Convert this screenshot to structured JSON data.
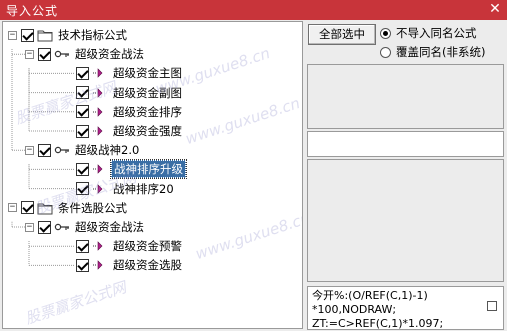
{
  "window": {
    "title": "导入公式",
    "close_glyph": "✕"
  },
  "tree": {
    "nodes": [
      {
        "label": "技术指标公式",
        "type": "folder",
        "expander": "−",
        "checked": true,
        "selected": false
      },
      {
        "label": "超级资金战法",
        "type": "key",
        "expander": "−",
        "checked": true,
        "selected": false
      },
      {
        "label": "超级资金主图",
        "type": "formula",
        "expander": "",
        "checked": true,
        "selected": false
      },
      {
        "label": "超级资金副图",
        "type": "formula",
        "expander": "",
        "checked": true,
        "selected": false
      },
      {
        "label": "超级资金排序",
        "type": "formula",
        "expander": "",
        "checked": true,
        "selected": false
      },
      {
        "label": "超级资金强度",
        "type": "formula",
        "expander": "",
        "checked": true,
        "selected": false
      },
      {
        "label": "超级战神2.0",
        "type": "key",
        "expander": "−",
        "checked": true,
        "selected": false
      },
      {
        "label": "战神排序升级",
        "type": "formula",
        "expander": "",
        "checked": true,
        "selected": true
      },
      {
        "label": "战神排序20",
        "type": "formula",
        "expander": "",
        "checked": true,
        "selected": false
      },
      {
        "label": "条件选股公式",
        "type": "folder",
        "expander": "−",
        "checked": true,
        "selected": false
      },
      {
        "label": "超级资金战法",
        "type": "key",
        "expander": "−",
        "checked": true,
        "selected": false
      },
      {
        "label": "超级资金预警",
        "type": "formula",
        "expander": "",
        "checked": true,
        "selected": false
      },
      {
        "label": "超级资金选股",
        "type": "formula",
        "expander": "",
        "checked": true,
        "selected": false
      }
    ]
  },
  "watermarks": [
    "www.guxue8.cn",
    "股票赢家公式网",
    "www.guxue8.cn",
    "股票赢家公式网",
    "www.guxue8.cn",
    "股票赢家公式网"
  ],
  "buttons": {
    "select_all": "全部选中"
  },
  "options": [
    {
      "label": "不导入同名公式",
      "selected": true
    },
    {
      "label": "覆盖同名(非系统)",
      "selected": false
    }
  ],
  "formula_preview": {
    "lines": [
      "今开%:(O/REF(C,1)-1)",
      "*100,NODRAW;",
      "ZT:=C>REF(C,1)*1.097;"
    ]
  },
  "colors": {
    "titlebar": "#c8343a",
    "selection": "#3a6ea5",
    "formula_icon": "#b0208a"
  }
}
